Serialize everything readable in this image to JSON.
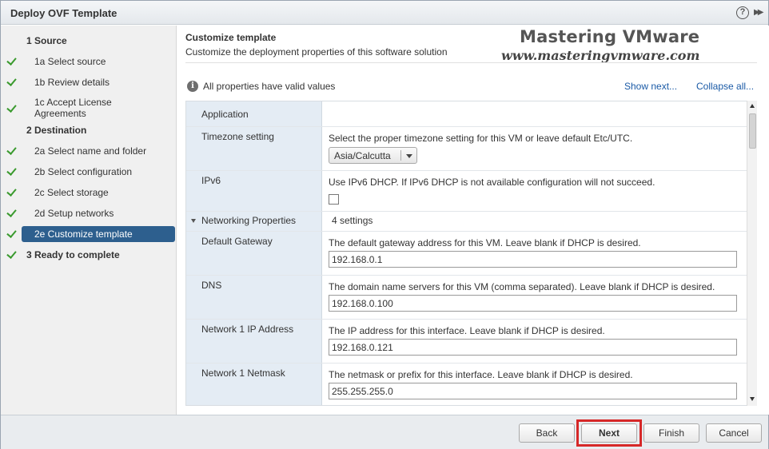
{
  "window": {
    "title": "Deploy OVF Template"
  },
  "sidebar": {
    "steps": [
      {
        "label": "1  Source",
        "group": true,
        "done": false
      },
      {
        "label": "1a  Select source",
        "done": true
      },
      {
        "label": "1b  Review details",
        "done": true
      },
      {
        "label": "1c  Accept License Agreements",
        "done": true
      },
      {
        "label": "2  Destination",
        "group": true,
        "done": false
      },
      {
        "label": "2a  Select name and folder",
        "done": true
      },
      {
        "label": "2b  Select configuration",
        "done": true
      },
      {
        "label": "2c  Select storage",
        "done": true
      },
      {
        "label": "2d  Setup networks",
        "done": true
      },
      {
        "label": "2e  Customize template",
        "done": true,
        "active": true
      },
      {
        "label": "3  Ready to complete",
        "group": true,
        "done": true
      }
    ]
  },
  "header": {
    "title": "Customize template",
    "subtitle": "Customize the deployment properties of this software solution"
  },
  "watermark": {
    "line1": "Mastering VMware",
    "line2": "www.masteringvmware.com"
  },
  "validation": {
    "message": "All properties have valid values",
    "show_next": "Show next...",
    "collapse_all": "Collapse all..."
  },
  "properties": {
    "application": "Application",
    "timezone": {
      "name": "Timezone setting",
      "desc": "Select the proper timezone setting for this VM or leave default Etc/UTC.",
      "value": "Asia/Calcutta"
    },
    "ipv6": {
      "name": "IPv6",
      "desc": "Use IPv6 DHCP. If IPv6 DHCP is not available configuration will not succeed.",
      "checked": false
    },
    "networking": {
      "name": "Networking Properties",
      "count": "4 settings"
    },
    "gateway": {
      "name": "Default Gateway",
      "desc": "The default gateway address for this VM. Leave blank if DHCP is desired.",
      "value": "192.168.0.1"
    },
    "dns": {
      "name": "DNS",
      "desc": "The domain name servers for this VM (comma separated). Leave blank if DHCP is desired.",
      "value": "192.168.0.100"
    },
    "ip": {
      "name": "Network 1 IP Address",
      "desc": "The IP address for this interface. Leave blank if DHCP is desired.",
      "value": "192.168.0.121"
    },
    "netmask": {
      "name": "Network 1 Netmask",
      "desc": "The netmask or prefix for this interface. Leave blank if DHCP is desired.",
      "value": "255.255.255.0"
    }
  },
  "footer": {
    "back": "Back",
    "next": "Next",
    "finish": "Finish",
    "cancel": "Cancel"
  },
  "colors": {
    "accent_active_step": "#2d5f8e",
    "check_green": "#3a9a2e",
    "link_blue": "#1a5aa6",
    "highlight_red": "#d62828"
  }
}
